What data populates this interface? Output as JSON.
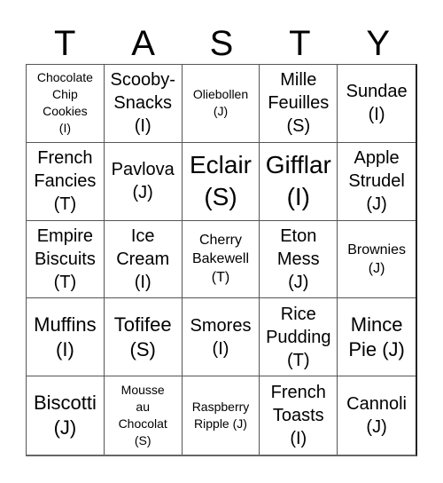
{
  "title_letters": [
    "T",
    "A",
    "S",
    "T",
    "Y"
  ],
  "cells": [
    {
      "text": "Chocolate\nChip\nCookies\n(I)",
      "size": "s-xs"
    },
    {
      "text": "Scooby-\nSnacks\n(I)",
      "size": "s-md"
    },
    {
      "text": "Oliebollen\n(J)",
      "size": "s-xs"
    },
    {
      "text": "Mille\nFeuilles\n(S)",
      "size": "s-md"
    },
    {
      "text": "Sundae\n(I)",
      "size": "s-md"
    },
    {
      "text": "French\nFancies\n(T)",
      "size": "s-md"
    },
    {
      "text": "Pavlova\n(J)",
      "size": "s-md"
    },
    {
      "text": "Eclair\n(S)",
      "size": "s-xl"
    },
    {
      "text": "Gifflar\n(I)",
      "size": "s-xl"
    },
    {
      "text": "Apple\nStrudel\n(J)",
      "size": "s-md"
    },
    {
      "text": "Empire\nBiscuits\n(T)",
      "size": "s-md"
    },
    {
      "text": "Ice\nCream\n(I)",
      "size": "s-md"
    },
    {
      "text": "Cherry\nBakewell\n(T)",
      "size": "s-sm"
    },
    {
      "text": "Eton\nMess\n(J)",
      "size": "s-md"
    },
    {
      "text": "Brownies\n(J)",
      "size": "s-sm"
    },
    {
      "text": "Muffins\n(I)",
      "size": "s-lg"
    },
    {
      "text": "Tofifee\n(S)",
      "size": "s-lg"
    },
    {
      "text": "Smores\n(I)",
      "size": "s-md"
    },
    {
      "text": "Rice\nPudding\n(T)",
      "size": "s-md"
    },
    {
      "text": "Mince\nPie (J)",
      "size": "s-lg"
    },
    {
      "text": "Biscotti\n(J)",
      "size": "s-lg"
    },
    {
      "text": "Mousse\nau\nChocolat\n(S)",
      "size": "s-xs"
    },
    {
      "text": "Raspberry\nRipple (J)",
      "size": "s-xs"
    },
    {
      "text": "French\nToasts\n(I)",
      "size": "s-md"
    },
    {
      "text": "Cannoli\n(J)",
      "size": "s-md"
    }
  ]
}
